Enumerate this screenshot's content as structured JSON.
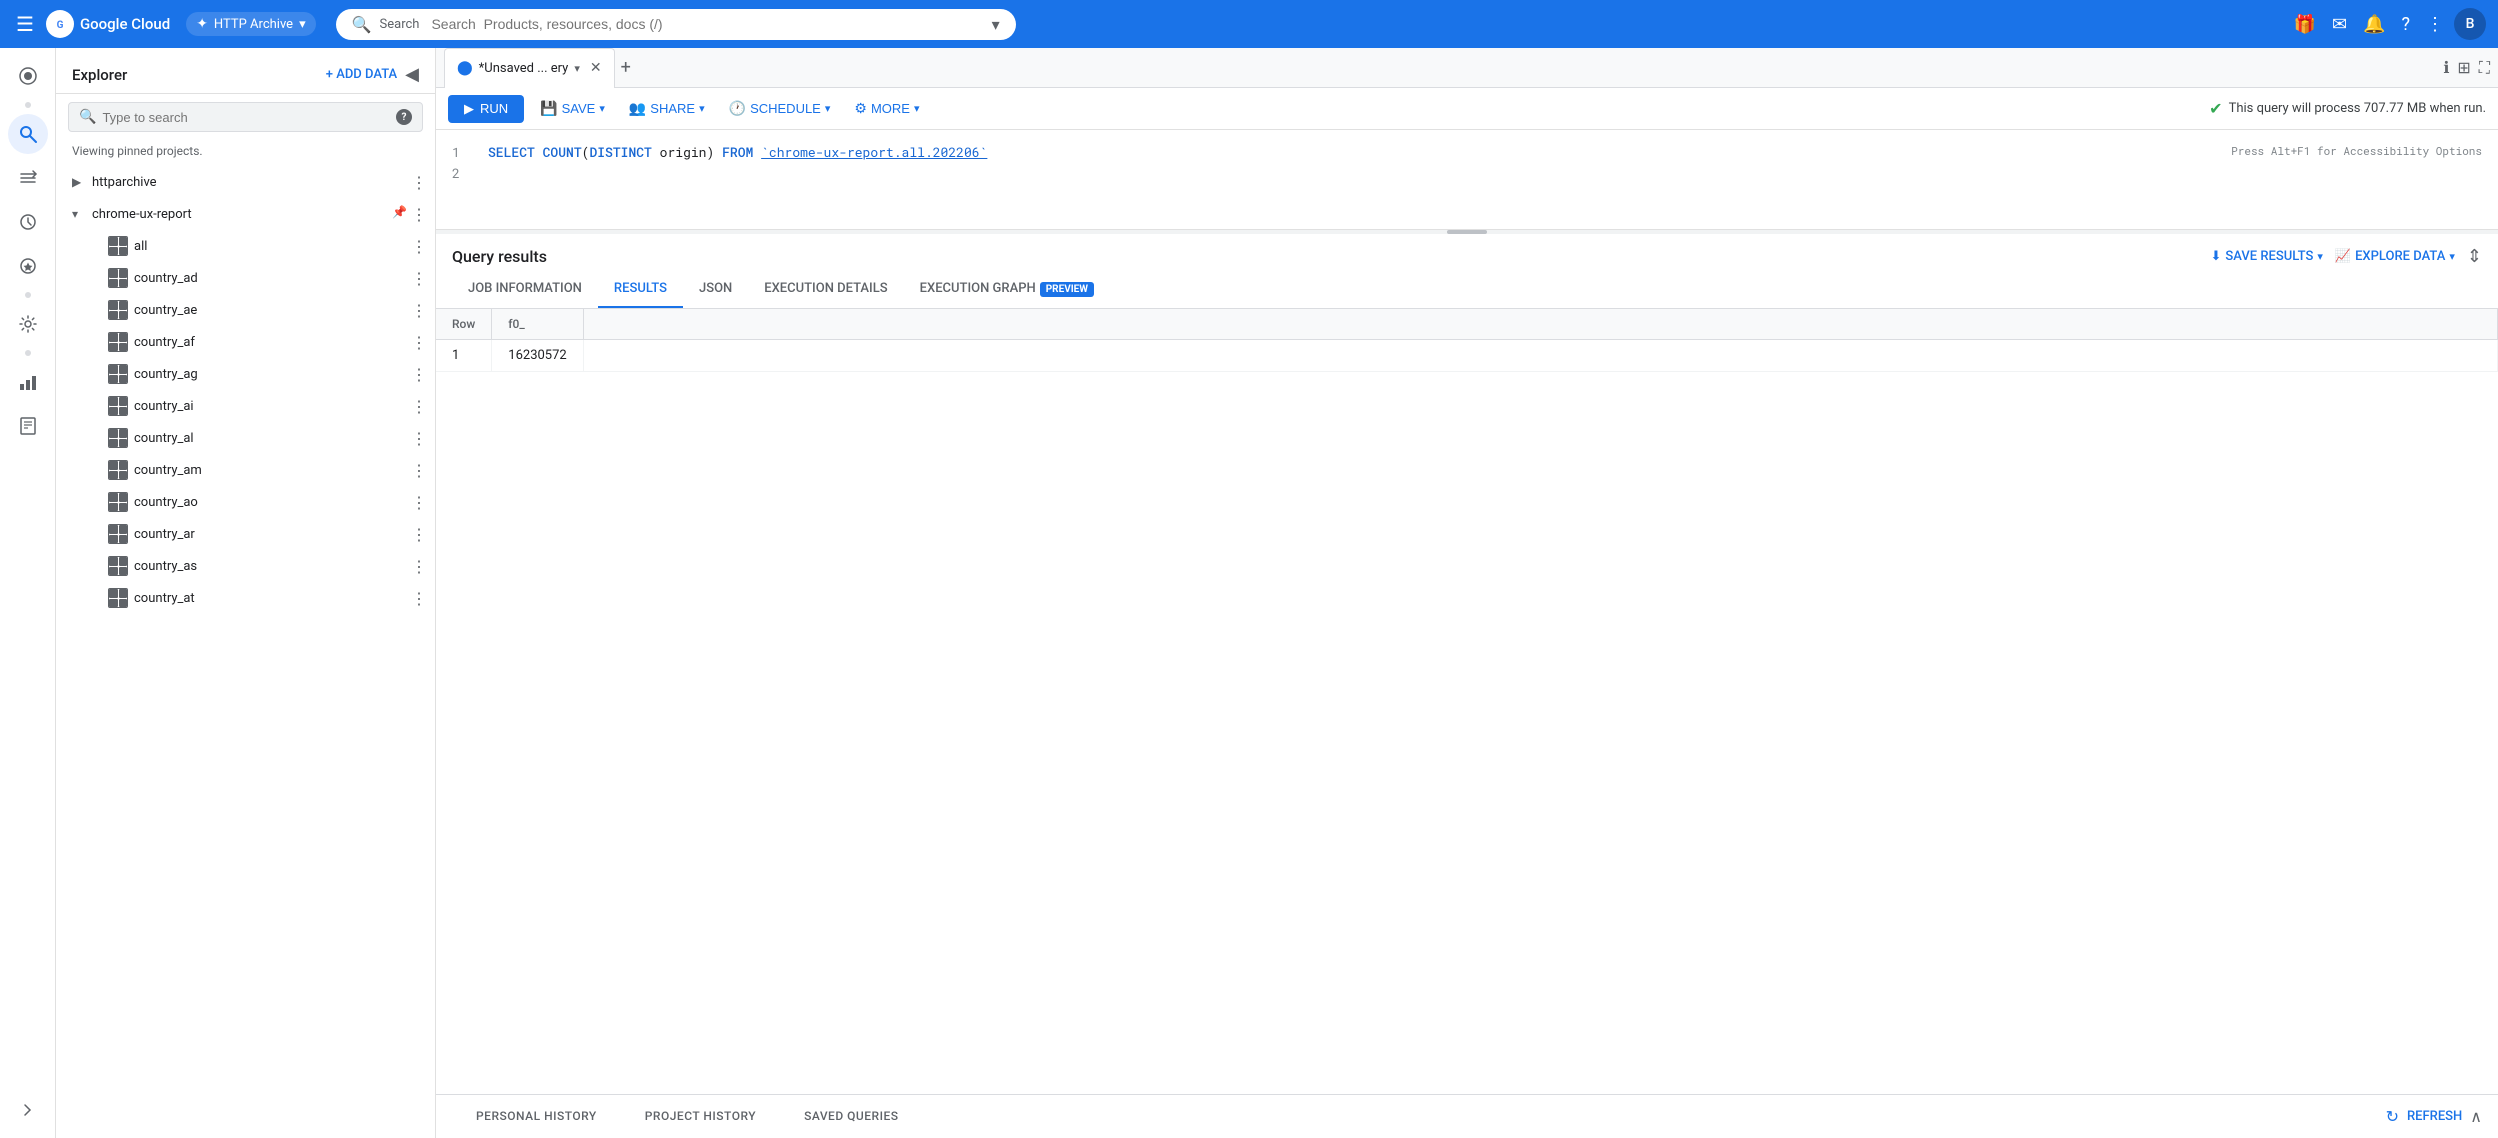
{
  "topNav": {
    "hamburger": "☰",
    "logoText": "Google Cloud",
    "projectName": "HTTP Archive",
    "searchPlaceholder": "Search  Products, resources, docs (/)",
    "navIcons": [
      "🎁",
      "✉",
      "🔔",
      "?",
      "⋮"
    ],
    "avatarText": "B"
  },
  "iconSidebar": {
    "icons": [
      "🔍",
      "⇄",
      "🕐",
      "🎭",
      "⚙",
      "📊",
      "📋"
    ]
  },
  "explorer": {
    "title": "Explorer",
    "addDataLabel": "+ ADD DATA",
    "collapseIcon": "◀",
    "searchPlaceholder": "Type to search",
    "viewingText": "Viewing pinned projects.",
    "tree": [
      {
        "id": "httparchive",
        "label": "httparchive",
        "indent": 0,
        "expanded": false,
        "hasTable": false
      },
      {
        "id": "chrome-ux-report",
        "label": "chrome-ux-report",
        "indent": 0,
        "expanded": true,
        "hasTable": false,
        "pinned": true
      },
      {
        "id": "all",
        "label": "all",
        "indent": 1,
        "expanded": false,
        "hasTable": true
      },
      {
        "id": "country_ad",
        "label": "country_ad",
        "indent": 1,
        "expanded": false,
        "hasTable": true
      },
      {
        "id": "country_ae",
        "label": "country_ae",
        "indent": 1,
        "expanded": false,
        "hasTable": true
      },
      {
        "id": "country_af",
        "label": "country_af",
        "indent": 1,
        "expanded": false,
        "hasTable": true
      },
      {
        "id": "country_ag",
        "label": "country_ag",
        "indent": 1,
        "expanded": false,
        "hasTable": true
      },
      {
        "id": "country_ai",
        "label": "country_ai",
        "indent": 1,
        "expanded": false,
        "hasTable": true
      },
      {
        "id": "country_al",
        "label": "country_al",
        "indent": 1,
        "expanded": false,
        "hasTable": true
      },
      {
        "id": "country_am",
        "label": "country_am",
        "indent": 1,
        "expanded": false,
        "hasTable": true
      },
      {
        "id": "country_ao",
        "label": "country_ao",
        "indent": 1,
        "expanded": false,
        "hasTable": true
      },
      {
        "id": "country_ar",
        "label": "country_ar",
        "indent": 1,
        "expanded": false,
        "hasTable": true
      },
      {
        "id": "country_as",
        "label": "country_as",
        "indent": 1,
        "expanded": false,
        "hasTable": true
      },
      {
        "id": "country_at",
        "label": "country_at",
        "indent": 1,
        "expanded": false,
        "hasTable": true
      }
    ]
  },
  "queryTab": {
    "icon": "⬤",
    "label": "*Unsaved ... ery",
    "closeIcon": "✕",
    "newTabIcon": "+"
  },
  "queryTabRightIcons": {
    "info": "ℹ",
    "table": "⊞",
    "fullscreen": "⛶"
  },
  "toolbar": {
    "runLabel": "RUN",
    "runIcon": "▶",
    "saveLabel": "SAVE",
    "saveIcon": "💾",
    "shareLabel": "SHARE",
    "shareIcon": "👥",
    "scheduleLabel": "SCHEDULE",
    "scheduleIcon": "🕐",
    "moreLabel": "MORE",
    "moreIcon": "⚙",
    "queryInfo": "This query will process 707.77 MB when run.",
    "queryInfoIcon": "✔"
  },
  "codeEditor": {
    "lines": [
      {
        "num": "1",
        "code": "SELECT COUNT(DISTINCT origin) FROM `chrome-ux-report.all.202206`"
      },
      {
        "num": "2",
        "code": ""
      }
    ],
    "accessibilityHint": "Press Alt+F1 for Accessibility Options"
  },
  "results": {
    "title": "Query results",
    "saveResultsLabel": "SAVE RESULTS",
    "saveResultsIcon": "⬇",
    "exploreDataLabel": "EXPLORE DATA",
    "exploreDataIcon": "📈",
    "tabs": [
      {
        "id": "job-info",
        "label": "JOB INFORMATION",
        "active": false
      },
      {
        "id": "results",
        "label": "RESULTS",
        "active": true
      },
      {
        "id": "json",
        "label": "JSON",
        "active": false
      },
      {
        "id": "execution-details",
        "label": "EXECUTION DETAILS",
        "active": false
      },
      {
        "id": "execution-graph",
        "label": "EXECUTION GRAPH",
        "active": false,
        "badge": "PREVIEW"
      }
    ],
    "tableHeaders": [
      "Row",
      "f0_"
    ],
    "tableRows": [
      [
        "1",
        "16230572"
      ]
    ]
  },
  "historyBar": {
    "tabs": [
      {
        "id": "personal-history",
        "label": "PERSONAL HISTORY"
      },
      {
        "id": "project-history",
        "label": "PROJECT HISTORY"
      },
      {
        "id": "saved-queries",
        "label": "SAVED QUERIES"
      }
    ],
    "refreshLabel": "REFRESH",
    "refreshIcon": "↻",
    "collapseIcon": "∧"
  }
}
